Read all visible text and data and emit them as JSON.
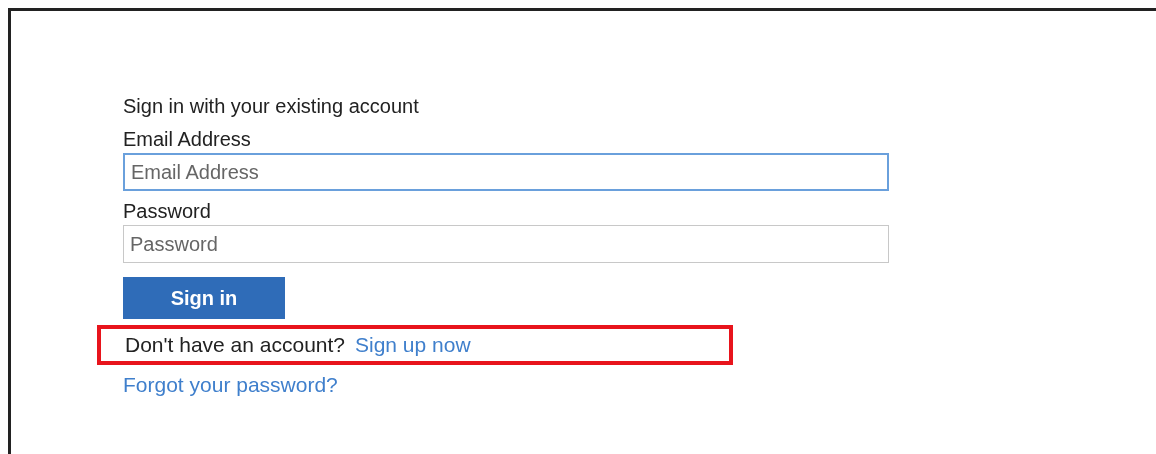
{
  "heading": "Sign in with your existing account",
  "fields": [
    {
      "label": "Email Address",
      "placeholder": "Email Address",
      "focused": true
    },
    {
      "label": "Password",
      "placeholder": "Password",
      "focused": false
    }
  ],
  "submit": "Sign in",
  "signup": {
    "prompt": "Don't have an account?",
    "link": "Sign up now",
    "highlighted": true
  },
  "forgot": "Forgot your password?"
}
